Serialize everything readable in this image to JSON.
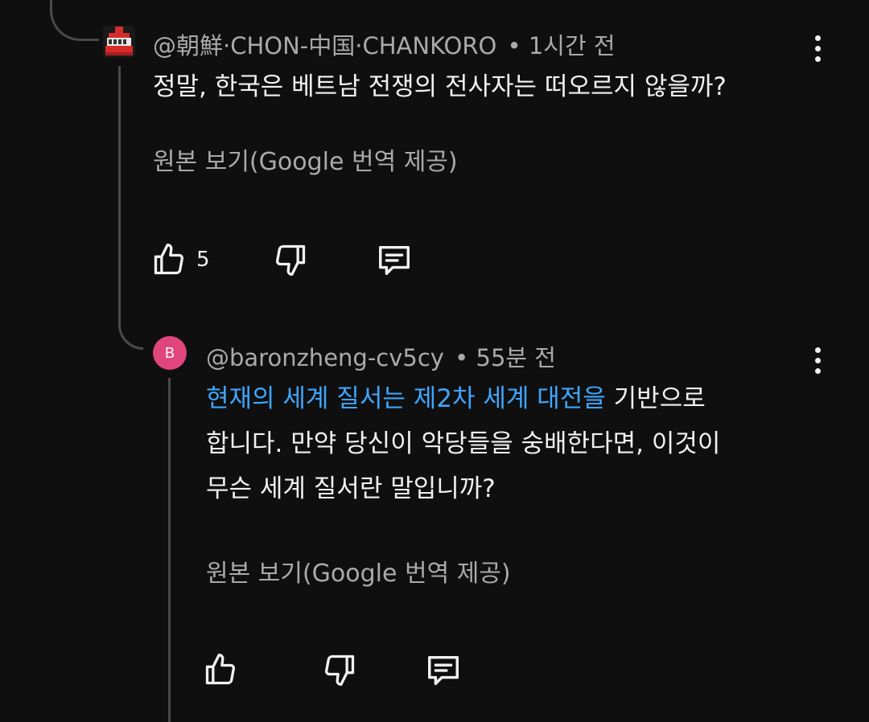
{
  "comments": [
    {
      "author": "@朝鮮·CHON-中国·CHANKORO",
      "time": "• 1시간 전",
      "text": "정말, 한국은 베트남 전쟁의 전사자는 떠오르지 않을까?",
      "see_original": "원본 보기(Google 번역 제공)",
      "likes": "5"
    },
    {
      "author": "@baronzheng-cv5cy",
      "time": "• 55분 전",
      "avatar_letter": "B",
      "avatar_color": "#e0457b",
      "text_link": "현재의 세계 질서는 제2차 세계 대전을",
      "text_line1_rest": " 기반으로",
      "text_line2": "합니다. 만약 당신이 악당들을 숭배한다면, 이것이",
      "text_line3": "무슨 세계 질서란 말입니까?",
      "see_original": "원본 보기(Google 번역 제공)"
    }
  ],
  "icons": {
    "like": "thumbs-up-icon",
    "dislike": "thumbs-down-icon",
    "reply": "reply-comment-icon",
    "more": "more-vertical-icon"
  },
  "colors": {
    "background": "#0f0f0f",
    "link": "#3ea6ff",
    "secondary_text": "#aaaaaa"
  }
}
